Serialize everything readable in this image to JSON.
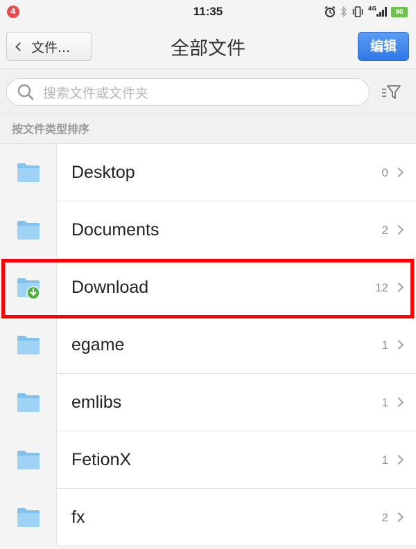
{
  "status_bar": {
    "notification_count": "4",
    "time": "11:35",
    "network": "4G",
    "battery": "90"
  },
  "nav": {
    "back_label": "文件...",
    "title": "全部文件",
    "edit_label": "编辑"
  },
  "search": {
    "placeholder": "搜索文件或文件夹"
  },
  "section": {
    "sort_label": "按文件类型排序"
  },
  "files": [
    {
      "name": "Desktop",
      "count": "0",
      "icon": "folder-icon"
    },
    {
      "name": "Documents",
      "count": "2",
      "icon": "folder-icon"
    },
    {
      "name": "Download",
      "count": "12",
      "icon": "download-folder-icon"
    },
    {
      "name": "egame",
      "count": "1",
      "icon": "folder-icon"
    },
    {
      "name": "emlibs",
      "count": "1",
      "icon": "folder-icon"
    },
    {
      "name": "FetionX",
      "count": "1",
      "icon": "folder-icon"
    },
    {
      "name": "fx",
      "count": "2",
      "icon": "folder-icon"
    }
  ],
  "colors": {
    "highlight": "#ff0000",
    "edit_button": "#3a82ea",
    "folder": "#8ecbf3",
    "download_badge": "#4bb33a"
  }
}
